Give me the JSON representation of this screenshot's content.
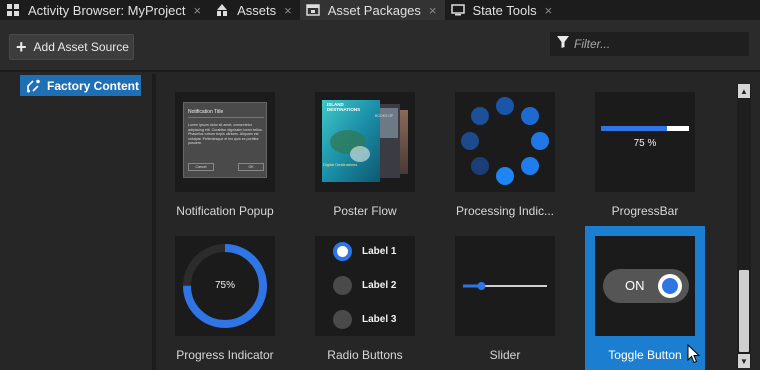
{
  "tabs": [
    {
      "label": "Activity Browser: MyProject",
      "icon": "activity-icon",
      "closable": true
    },
    {
      "label": "Assets",
      "icon": "assets-icon",
      "closable": true
    },
    {
      "label": "Asset Packages",
      "icon": "package-icon",
      "closable": true,
      "active": true
    },
    {
      "label": "State Tools",
      "icon": "monitor-icon",
      "closable": true
    }
  ],
  "tab_close_glyph": "×",
  "toolbar": {
    "add_asset_source_label": "Add Asset Source",
    "filter_placeholder": "Filter..."
  },
  "sidebar": {
    "items": [
      {
        "label": "Factory Content",
        "selected": true
      }
    ]
  },
  "assets": [
    {
      "name": "Notification Popup",
      "preview": {
        "title": "Notification Title",
        "body": "Lorem ipsum dolor sit amet, consectetur adipiscing elit. Curabitur dignissim lorem tellus. Phasellus rutrum turpis ultricies. Aliquam est volutpat. Pellentesque et leo quis ex porttitor posuere.",
        "cancel": "Cancel",
        "ok": "OK"
      }
    },
    {
      "name": "Poster Flow",
      "preview": {
        "heading": "ISLAND DESTINATIONS",
        "caption": "Digital Destinations",
        "back_caption": "BOOKS OF"
      }
    },
    {
      "name": "Processing Indic..."
    },
    {
      "name": "ProgressBar",
      "preview": {
        "value_label": "75 %",
        "progress": 0.75
      }
    },
    {
      "name": "Progress Indicator",
      "preview": {
        "value_label": "75%",
        "progress": 0.75
      }
    },
    {
      "name": "Radio Buttons",
      "preview": {
        "options": [
          "Label 1",
          "Label 2",
          "Label 3"
        ],
        "selected_index": 0
      }
    },
    {
      "name": "Slider",
      "preview": {
        "value": 0.22
      }
    },
    {
      "name": "Toggle Button",
      "preview": {
        "state_label": "ON"
      },
      "selected": true
    }
  ],
  "colors": {
    "accent": "#2f75e6",
    "selection": "#1b7ed1",
    "sidebar_selection": "#1f6fb5"
  }
}
